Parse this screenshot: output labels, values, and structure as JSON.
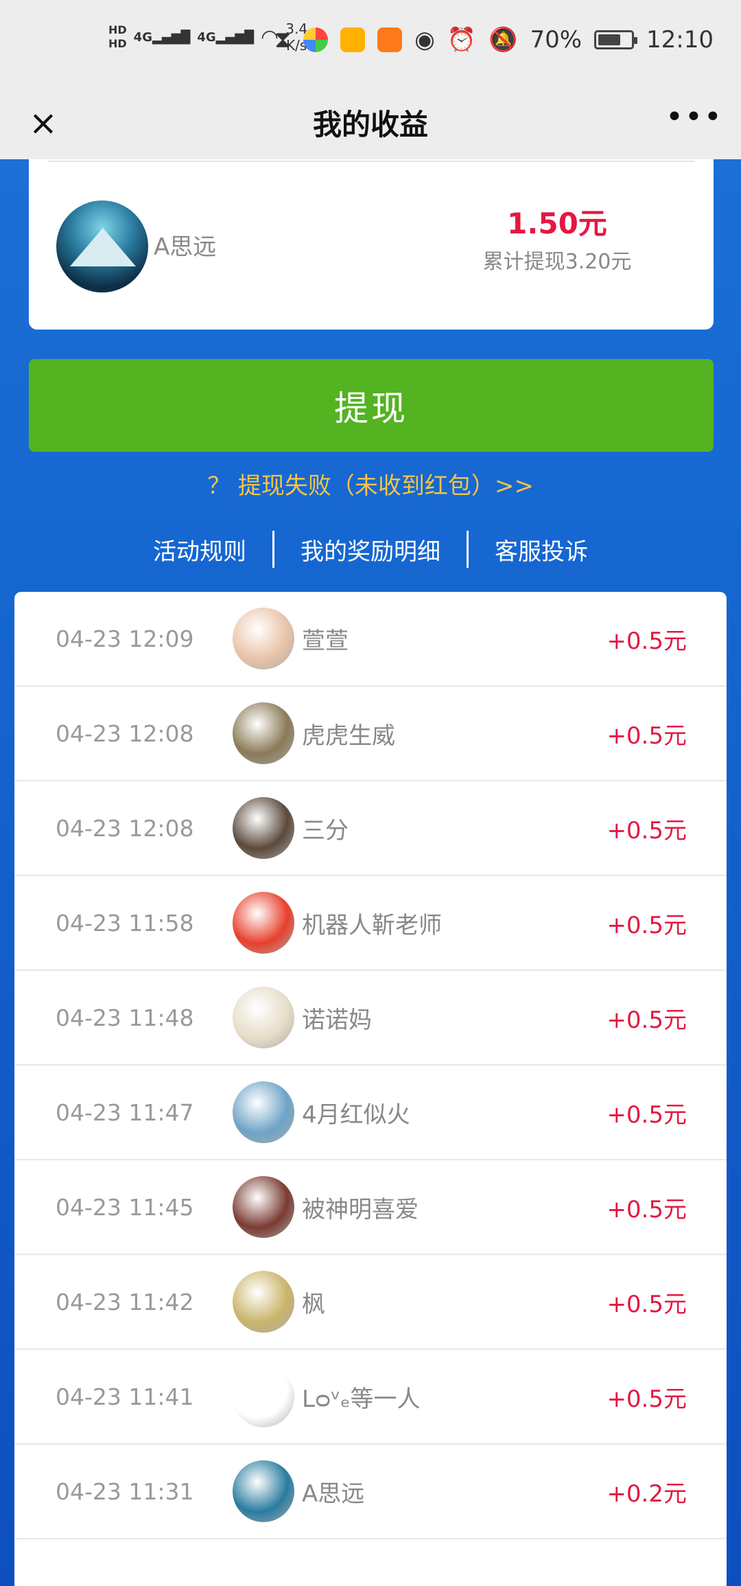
{
  "status": {
    "hd1": "HD",
    "hd2": "HD",
    "net1": "4G",
    "net2": "4G",
    "speed_value": "3.4",
    "speed_unit": "K/s",
    "battery": "70%",
    "time": "12:10",
    "battery_level": 0.7
  },
  "header": {
    "title": "我的收益",
    "close_icon": "×",
    "more_icon": "•••"
  },
  "summary": {
    "username": "A思远",
    "amount": "1.50元",
    "total_label": "累计提现3.20元"
  },
  "withdraw_button": "提现",
  "fail_link": "？ 提现失败（未收到红包）>>",
  "links": {
    "rules": "活动规则",
    "details": "我的奖励明细",
    "complaint": "客服投诉"
  },
  "records": [
    {
      "time": "04-23 12:09",
      "name": "萱萱",
      "amount": "+0.5元",
      "color": "#e9c3a8"
    },
    {
      "time": "04-23 12:08",
      "name": "虎虎生威",
      "amount": "+0.5元",
      "color": "#8a7a57"
    },
    {
      "time": "04-23 12:08",
      "name": "三分",
      "amount": "+0.5元",
      "color": "#5b4a3c"
    },
    {
      "time": "04-23 11:58",
      "name": "机器人靳老师",
      "amount": "+0.5元",
      "color": "#e8402c"
    },
    {
      "time": "04-23 11:48",
      "name": "诺诺妈",
      "amount": "+0.5元",
      "color": "#e7ddc8"
    },
    {
      "time": "04-23 11:47",
      "name": "4月红似火",
      "amount": "+0.5元",
      "color": "#6fa3c7"
    },
    {
      "time": "04-23 11:45",
      "name": "被神明喜爱",
      "amount": "+0.5元",
      "color": "#7a3b32"
    },
    {
      "time": "04-23 11:42",
      "name": "枫",
      "amount": "+0.5元",
      "color": "#c9b56a"
    },
    {
      "time": "04-23 11:41",
      "name": "Lᴑᵛₑ等一人",
      "amount": "+0.5元",
      "color": "#ffffff"
    },
    {
      "time": "04-23 11:31",
      "name": "A思远",
      "amount": "+0.2元",
      "color": "#2a7ca0"
    }
  ]
}
